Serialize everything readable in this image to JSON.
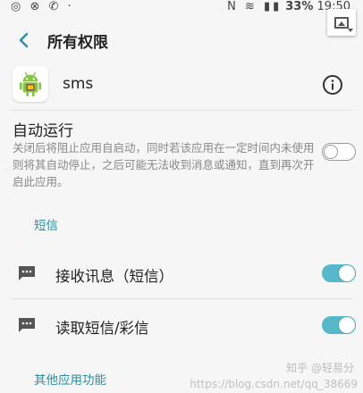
{
  "status_bar": {
    "left_icons": "◎ ⊗ ✆ ·",
    "right_icons": "N ≋ ▮▮",
    "battery_percent": "33%",
    "time": "19:50"
  },
  "header": {
    "title": "所有权限"
  },
  "app": {
    "name": "sms"
  },
  "autorun": {
    "title": "自动运行",
    "description": "关闭后将阻止应用自启动，同时若该应用在一定时间内未使用则将其自动停止，之后可能无法收到消息或通知，直到再次开启此应用。",
    "enabled": false
  },
  "sections": [
    {
      "header": "短信",
      "items": [
        {
          "label": "接收讯息（短信）",
          "enabled": true
        },
        {
          "label": "读取短信/彩信",
          "enabled": true
        }
      ]
    },
    {
      "header": "其他应用功能",
      "items": []
    }
  ],
  "watermarks": {
    "zhihu": "知乎 @轻易分",
    "csdn": "https://blog.csdn.net/qq_38669"
  },
  "colors": {
    "accent": "#56b8c8",
    "section_header": "#2a8fa2",
    "background": "#f6f6f6"
  }
}
